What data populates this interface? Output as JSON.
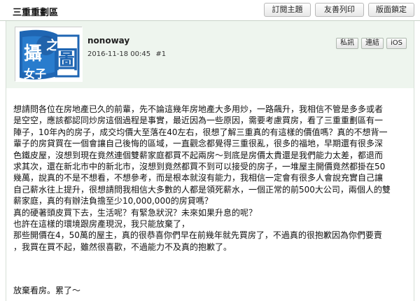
{
  "thread": {
    "title": "三重重劃區"
  },
  "toolbar": {
    "subscribe_label": "訂閱主題",
    "print_label": "友善列印",
    "lock_label": "版面鎖定"
  },
  "post": {
    "author": "nonoway",
    "date": "2016-11-18 00:45",
    "floor": "#1",
    "avatar": {
      "text_main": "攝",
      "text_sub": "之",
      "text_big": "圖",
      "text_small": "女子"
    },
    "actions": {
      "pm": "私訊",
      "link": "連結",
      "ios": "iOS"
    },
    "body": "想請問各位在房地產已久的前輩，先不論這幾年房地產大多用炒，一路飆升，我相信不管是多多或者\n是空空，應該都認同炒房這個過程是事實，最近因為一些原因，需要考慮買房，看了三重重劃區有一\n陣子，10年內的房子，成交均價大至落在40左右，很想了解三重真的有這樣的價值嗎？真的不想背一\n輩子的房貸買在一個會讓自己後悔的區域，一直觀念都覺得三重很亂，很多的福地，早期還有很多深\n色鐵皮屋，沒想到現在竟然連個雙薪家庭都買不起兩房～到底是房價太貴還是我們能力太差，都退而\n求其次，還在新北市中的新北市，沒想到竟然都買不到可以接受的房子，一堆屋主開價竟然都掛在50\n幾萬，說真的不是不想看，不想參考，而是根本就沒有能力，我相信一定會有很多人會說充實自己讓\n自己薪水往上提升，很想請問我相信大多數的人都是領死薪水，一個正常的前500大公司，兩個人的雙\n薪家庭，真的有辦法負擔至少10,000,000的房貸嗎？\n真的硬著頭皮買下去，生活呢？有緊急狀況？未來如果升息的呢？\n也許在這樣的環境跟房產現況，我只能放棄了，\n那些開價在4，50萬的屋主，真的很恭喜你們早在前幾年就先買房了，不過真的很抱歉因為你們要賣\n，我買在買不起，雖然很喜歡，不過能力不及真的抱歉了。",
    "closing": "放棄看房。累了～"
  },
  "colors": {
    "header_band": "#eef5ee",
    "border": "#c9d3c9",
    "avatar_blue": "#1f66b3"
  }
}
